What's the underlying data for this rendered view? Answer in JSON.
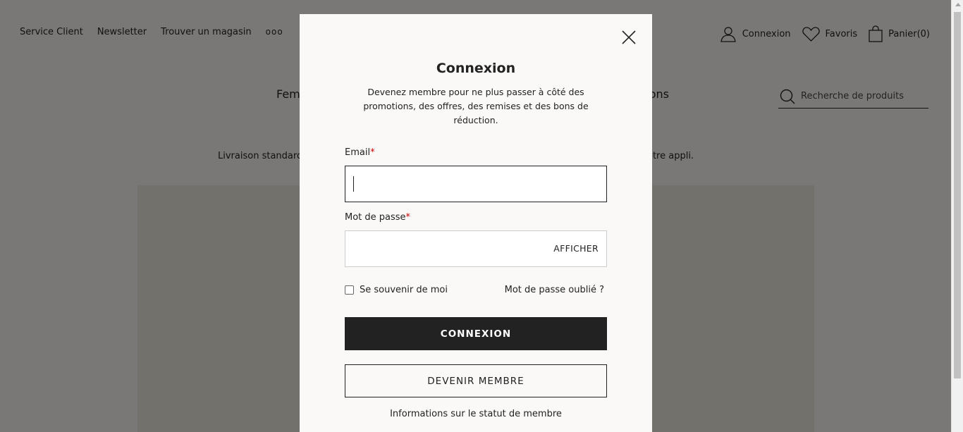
{
  "header": {
    "top_links": [
      "Service Client",
      "Newsletter",
      "Trouver un magasin"
    ],
    "more_label": "ooo",
    "account_label": "Connexion",
    "favorites_label": "Favoris",
    "cart_label": "Panier(0)"
  },
  "nav": {
    "left_partial": "Femm",
    "right_partial": "tions"
  },
  "search": {
    "placeholder": "Recherche de produits"
  },
  "promo": {
    "left_partial": "Livraison standard g",
    "right_partial": "otre appli."
  },
  "modal": {
    "title": "Connexion",
    "subtitle": "Devenez membre pour ne plus passer à côté des promotions, des offres, des remises et des bons de réduction.",
    "email_label": "Email",
    "email_value": "",
    "password_label": "Mot de passe",
    "password_value": "",
    "required_mark": "*",
    "show_password_label": "AFFICHER",
    "remember_label": "Se souvenir de moi",
    "remember_checked": false,
    "forgot_label": "Mot de passe oublié ?",
    "login_button": "CONNEXION",
    "join_button": "DEVENIR MEMBRE",
    "member_info_link": "Informations sur le statut de membre"
  },
  "icons": {
    "account": "user-icon",
    "favorites": "heart-icon",
    "cart": "bag-icon",
    "search": "search-icon",
    "close": "close-icon"
  },
  "colors": {
    "page_bg": "#f4f1ec",
    "modal_bg": "#faf9f8",
    "primary_button": "#222222",
    "required": "#cc0000"
  }
}
